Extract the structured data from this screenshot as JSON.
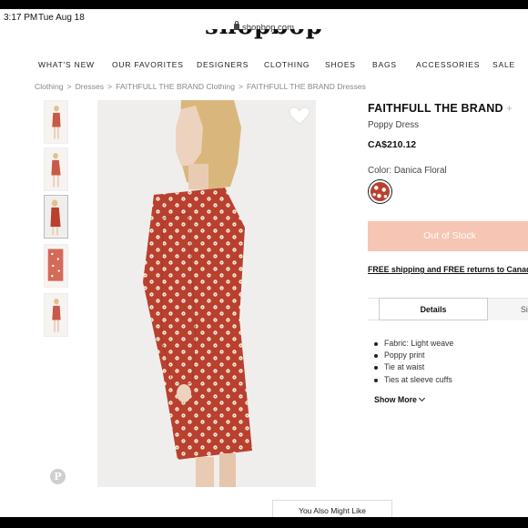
{
  "status_bar": {
    "time": "3:17 PM",
    "date": "Tue Aug 18"
  },
  "browser": {
    "url": "shopbop.com"
  },
  "site": {
    "logo": "shopbop"
  },
  "nav": {
    "items": [
      "WHAT'S NEW",
      "OUR FAVORITES",
      "DESIGNERS",
      "CLOTHING",
      "SHOES",
      "BAGS",
      "ACCESSORIES",
      "SALE"
    ]
  },
  "breadcrumb": {
    "items": [
      "Clothing",
      "Dresses",
      "FAITHFULL THE BRAND Clothing",
      "FAITHFULL THE BRAND Dresses"
    ],
    "separator": ">"
  },
  "product": {
    "brand": "FAITHFULL THE BRAND",
    "brand_plus": "+",
    "name": "Poppy Dress",
    "price": "CA$210.12",
    "color_label": "Color: Danica Floral",
    "stock_button": "Out of Stock",
    "shipping": "FREE shipping and FREE returns to Canada",
    "tabs": [
      "Details",
      "Siz"
    ],
    "details": [
      "Fabric: Light weave",
      "Poppy print",
      "Tie at waist",
      "Ties at sleeve cuffs"
    ],
    "show_more": "Show More"
  },
  "icons": {
    "heart": "heart-icon",
    "pinterest": "pinterest-icon",
    "lock": "lock-icon",
    "chevron": "chevron-down-icon"
  },
  "pinterest_glyph": "P",
  "also_like": "You Also Might Like",
  "colors": {
    "accent_button": "#f6c5b3",
    "dress": "#b9402f"
  }
}
